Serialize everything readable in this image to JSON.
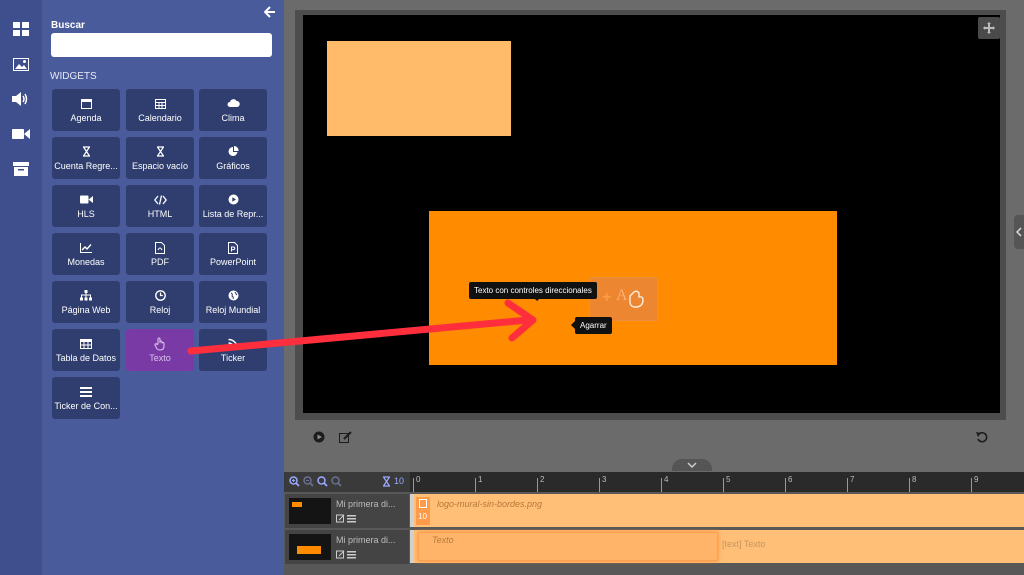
{
  "sidebar_rail": {
    "icons": [
      "layout-icon",
      "image-icon",
      "volume-icon",
      "video-icon",
      "archive-icon"
    ]
  },
  "panel": {
    "back_icon": "arrow-left-icon",
    "search_label": "Buscar",
    "search_placeholder": "",
    "widgets_heading": "WIDGETS",
    "widgets": [
      {
        "label": "Agenda",
        "icon": "calendar-icon"
      },
      {
        "label": "Calendario",
        "icon": "calendar-grid-icon"
      },
      {
        "label": "Clima",
        "icon": "cloud-icon"
      },
      {
        "label": "Cuenta Regre...",
        "icon": "hourglass-icon"
      },
      {
        "label": "Espacio vacío",
        "icon": "hourglass-icon"
      },
      {
        "label": "Gráficos",
        "icon": "pie-chart-icon"
      },
      {
        "label": "HLS",
        "icon": "video-icon"
      },
      {
        "label": "HTML",
        "icon": "code-icon"
      },
      {
        "label": "Lista de Repr...",
        "icon": "play-circle-icon"
      },
      {
        "label": "Monedas",
        "icon": "line-chart-icon"
      },
      {
        "label": "PDF",
        "icon": "pdf-file-icon"
      },
      {
        "label": "PowerPoint",
        "icon": "ppt-file-icon"
      },
      {
        "label": "Página Web",
        "icon": "sitemap-icon"
      },
      {
        "label": "Reloj",
        "icon": "clock-icon"
      },
      {
        "label": "Reloj Mundial",
        "icon": "globe-icon"
      },
      {
        "label": "Tabla de Datos",
        "icon": "table-icon"
      },
      {
        "label": "Texto",
        "icon": "hand-pointer-icon"
      },
      {
        "label": "Ticker",
        "icon": "rss-icon"
      },
      {
        "label": "Ticker de Con...",
        "icon": "list-icon"
      }
    ]
  },
  "stage": {
    "tooltip_text": "Texto con controles direccionales",
    "tooltip_grab": "Agarrar",
    "expand_icon": "move-icon"
  },
  "controls": {
    "play_icon": "play-icon",
    "edit_icon": "edit-icon",
    "undo_icon": "undo-icon"
  },
  "timeline": {
    "duration_label": "10",
    "ruler_ticks": [
      "0",
      "1",
      "2",
      "3",
      "4",
      "5",
      "6",
      "7",
      "8",
      "9"
    ],
    "rows": [
      {
        "name": "Mi primera di...",
        "item_label": "logo-mural-sin-bordes.png",
        "item_duration": "10"
      },
      {
        "name": "Mi primera di...",
        "item_label": "Texto",
        "item_secondary": "[text] Texto"
      }
    ]
  },
  "colors": {
    "region_light": "#ffbb6a",
    "region_orange": "#ff8c00",
    "active_widget": "#7a3aa6",
    "arrow": "#ff2e3c"
  }
}
